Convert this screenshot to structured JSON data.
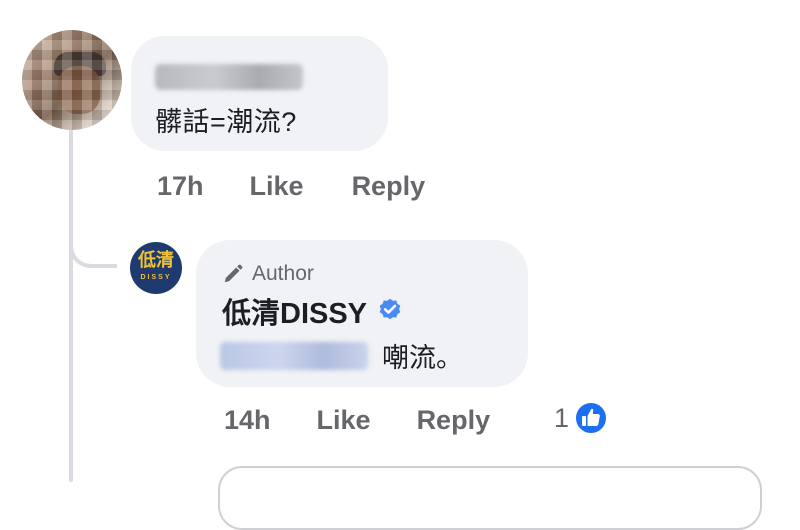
{
  "comment": {
    "text": "髒話=潮流?",
    "time": "17h",
    "like_label": "Like",
    "reply_label": "Reply"
  },
  "reply": {
    "badge_label": "Author",
    "author_name": "低清DISSY",
    "text": "嘲流。",
    "time": "14h",
    "like_label": "Like",
    "reply_label": "Reply",
    "reaction_count": "1"
  },
  "logo": {
    "top_text": "低清",
    "bottom_text": "DISSY"
  },
  "icons": {
    "author_badge": "pencil-icon",
    "verified": "verified-check-icon",
    "reaction": "like-thumb-icon"
  },
  "colors": {
    "bubble": "#f0f2f5",
    "action_text": "#65676b",
    "verified_blue": "#1877f2",
    "logo_bg": "#1f3a6f",
    "logo_gold": "#f1c232"
  }
}
